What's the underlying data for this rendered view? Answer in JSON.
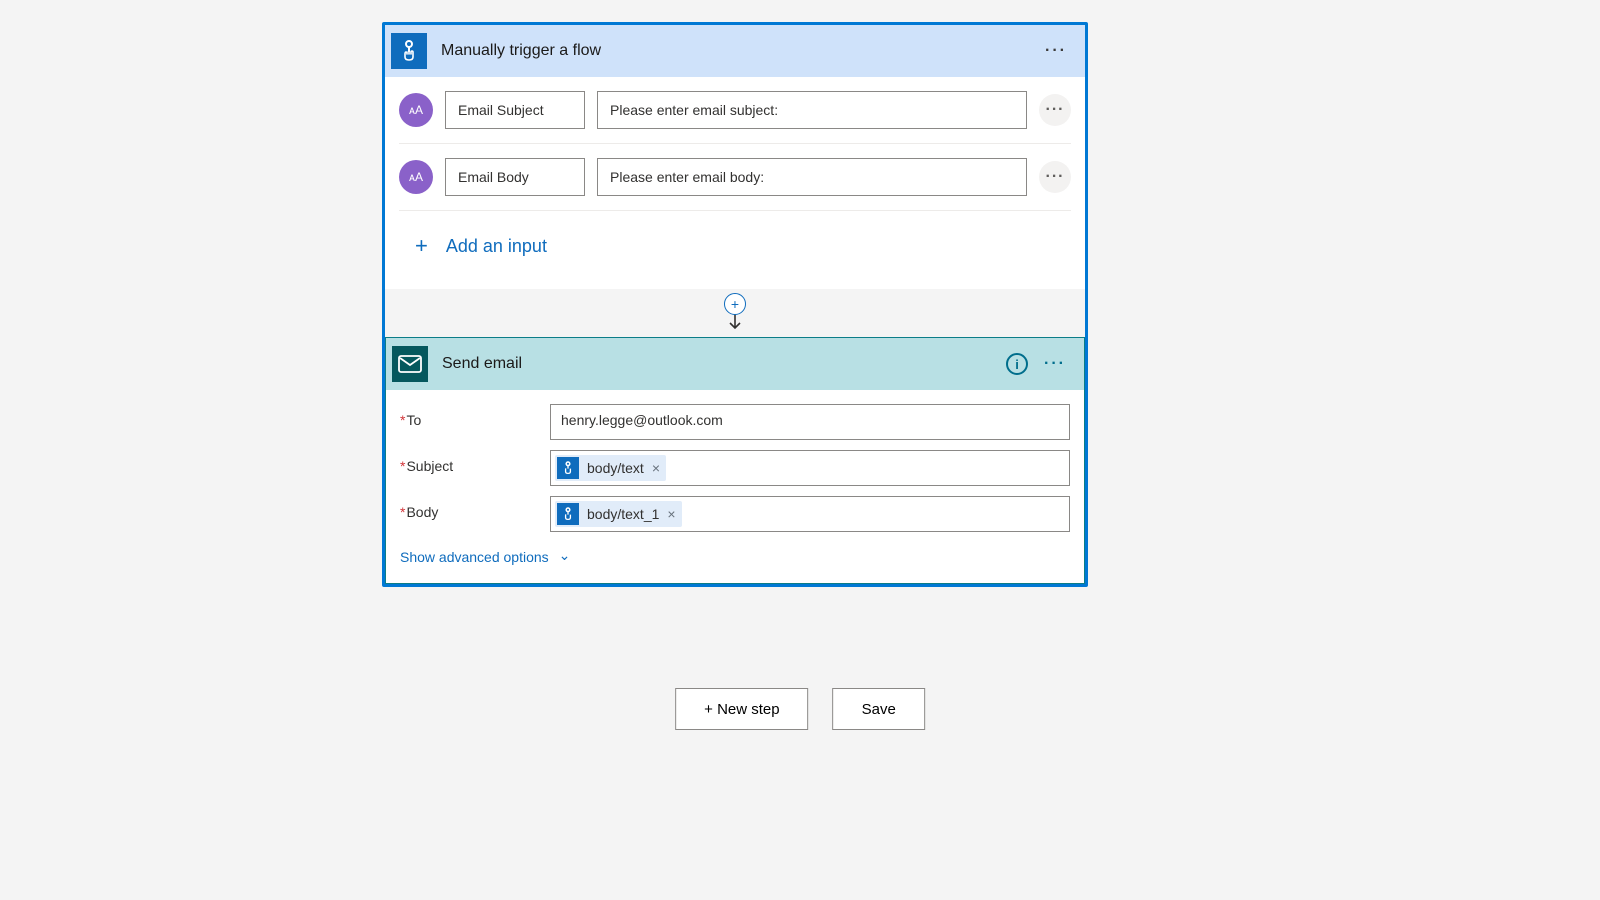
{
  "trigger": {
    "title": "Manually trigger a flow",
    "inputs": [
      {
        "name": "Email Subject",
        "prompt": "Please enter email subject:"
      },
      {
        "name": "Email Body",
        "prompt": "Please enter email body:"
      }
    ],
    "add_input_label": "Add an input"
  },
  "action": {
    "title": "Send email",
    "fields": {
      "to": {
        "label": "To",
        "value": "henry.legge@outlook.com"
      },
      "subject": {
        "label": "Subject",
        "token": "body/text"
      },
      "body": {
        "label": "Body",
        "token": "body/text_1"
      }
    },
    "advanced_label": "Show advanced options"
  },
  "buttons": {
    "new_step": "+ New step",
    "save": "Save"
  },
  "icons": {
    "text_type": "ᴀA",
    "info": "i",
    "ellipsis": "···",
    "plus": "+",
    "remove": "×",
    "chevron_down": "⌄"
  },
  "colors": {
    "selection": "#0078d4",
    "trigger_header": "#cfe2fa",
    "trigger_icon": "#0f6cbd",
    "action_header": "#b8e0e4",
    "action_icon": "#05585e",
    "text_badge": "#8a61c9",
    "link": "#0f6cbd"
  }
}
